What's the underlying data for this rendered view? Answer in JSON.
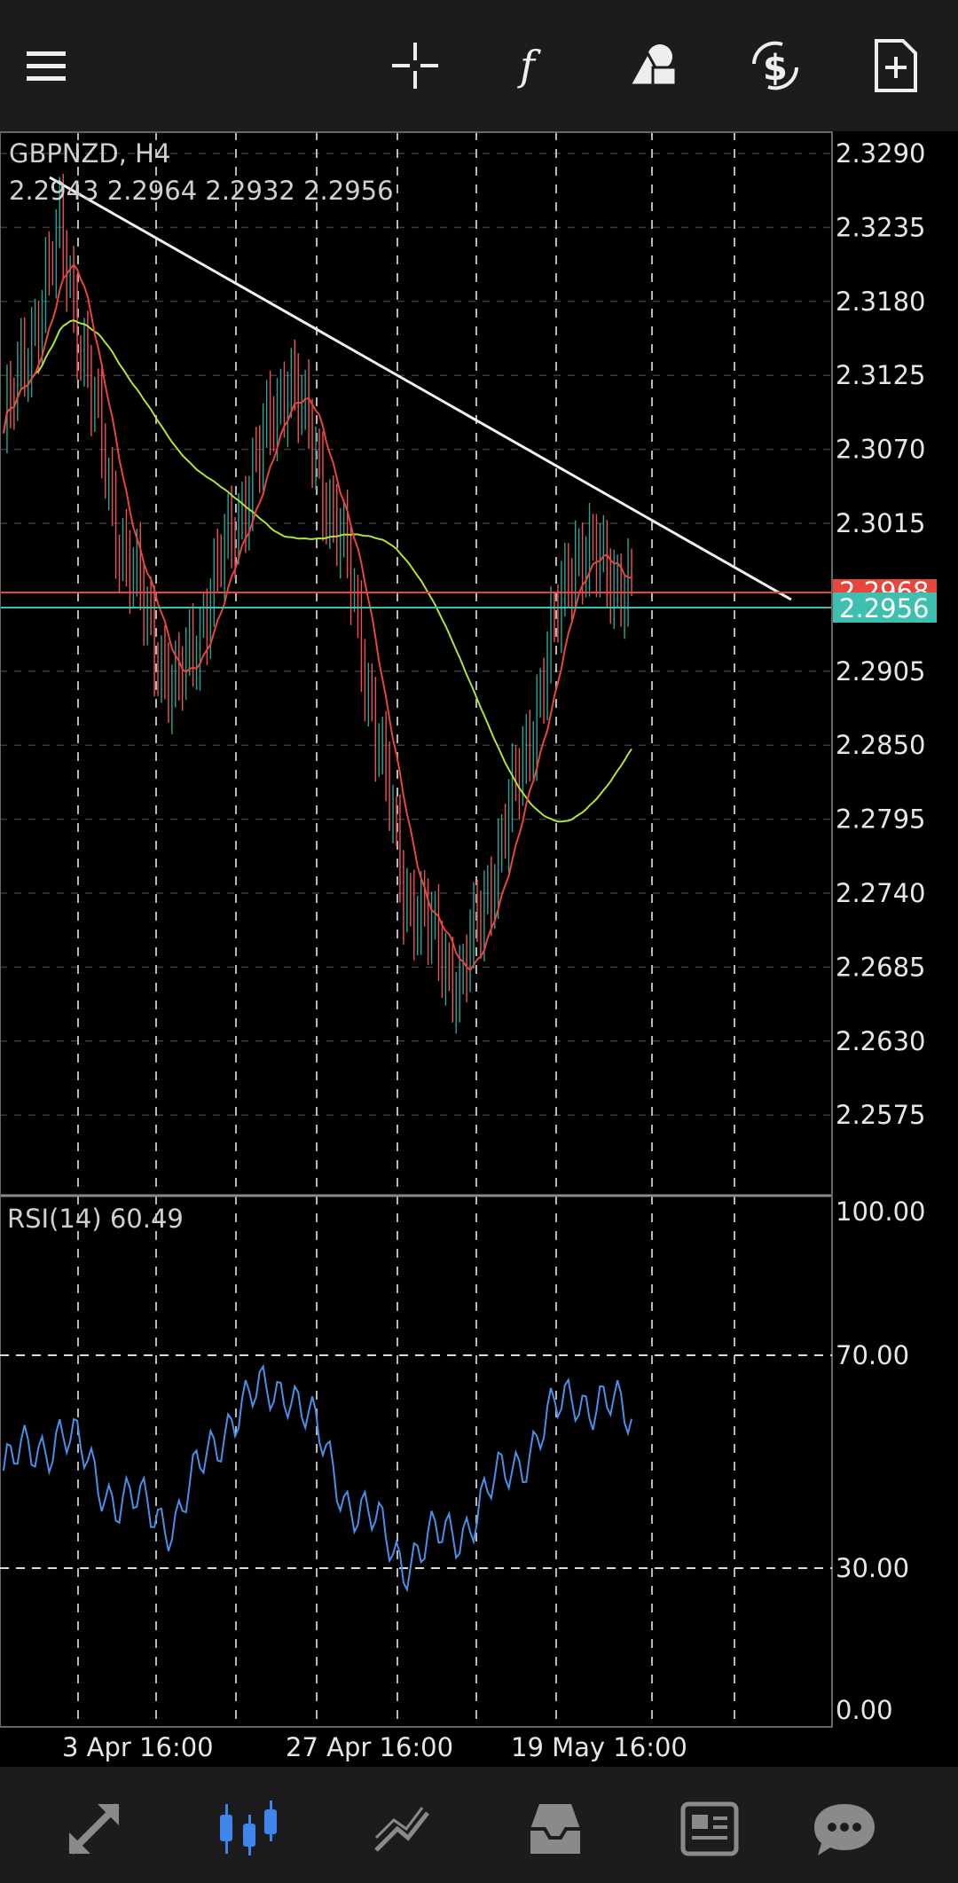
{
  "toolbar": {
    "icons": [
      "menu-icon",
      "crosshair-icon",
      "function-icon",
      "objects-icon",
      "currency-swap-icon",
      "new-order-icon"
    ]
  },
  "chart": {
    "symbol_label": "GBPNZD, H4",
    "ohlc_label": "2.2943 2.2964 2.2932 2.2956",
    "price_axis": [
      "2.3290",
      "2.3235",
      "2.3180",
      "2.3125",
      "2.3070",
      "2.3015",
      "2.2905",
      "2.2850",
      "2.2795",
      "2.2740",
      "2.2685",
      "2.2630",
      "2.2575"
    ],
    "ask_price": "2.2968",
    "bid_price": "2.2956",
    "colors": {
      "bull": "#26a69a",
      "bear": "#ef5350",
      "ma_fast": "#e8453c",
      "ma_slow": "#aee33a",
      "rsi": "#4a8fe7",
      "ask_line": "#e8453c",
      "bid_line": "#3fbfb0"
    },
    "time_labels": [
      "3 Apr 16:00",
      "27 Apr 16:00",
      "19 May 16:00"
    ]
  },
  "rsi": {
    "label": "RSI(14) 60.49",
    "axis": [
      "100.00",
      "70.00",
      "30.00",
      "0.00"
    ]
  },
  "bottom_nav": {
    "items": [
      "quotes-icon",
      "chart-icon",
      "trade-icon",
      "history-icon",
      "news-icon",
      "chat-icon"
    ],
    "active": "chart-icon"
  },
  "chart_data": {
    "type": "line",
    "title": "GBPNZD, H4",
    "ylim": [
      2.254,
      2.331
    ],
    "x": [
      "3 Apr 16:00",
      "27 Apr 16:00",
      "19 May 16:00"
    ],
    "series": [
      {
        "name": "GBPNZD",
        "values": [
          2.308,
          2.324,
          2.3,
          2.287,
          2.3,
          2.313,
          2.298,
          2.272,
          2.264,
          2.28,
          2.299,
          2.2956
        ]
      },
      {
        "name": "RSI(14)",
        "values": [
          50,
          58,
          44,
          40,
          62,
          68,
          45,
          32,
          38,
          52,
          66,
          60.49
        ]
      }
    ],
    "rsi_levels": [
      70,
      30
    ]
  }
}
